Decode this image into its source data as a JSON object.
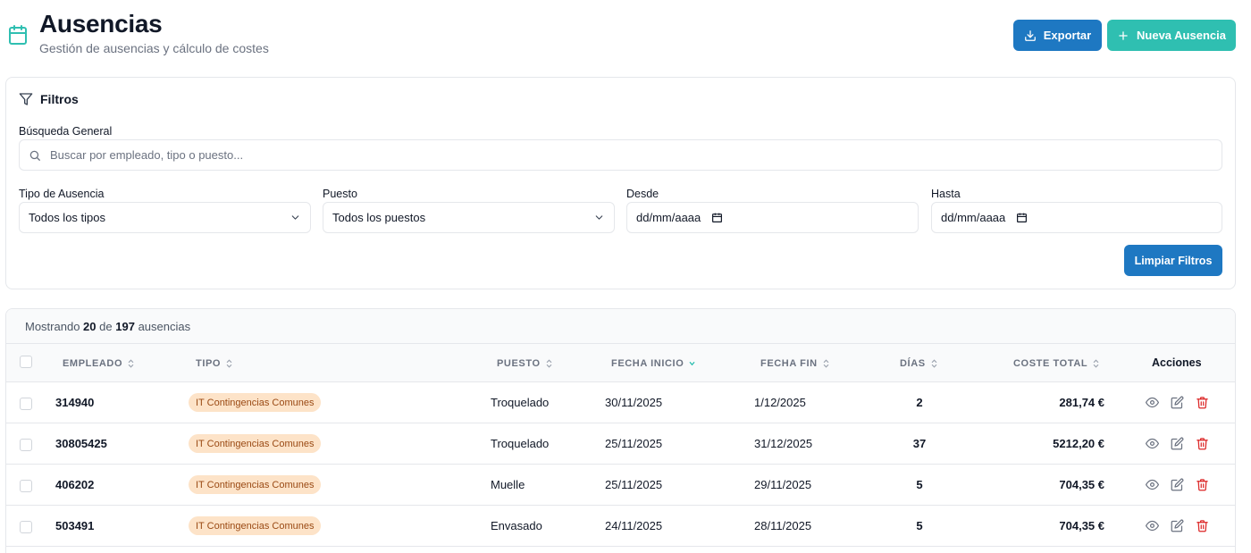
{
  "header": {
    "title": "Ausencias",
    "subtitle": "Gestión de ausencias y cálculo de costes",
    "export_label": "Exportar",
    "new_label": "Nueva Ausencia"
  },
  "filters": {
    "title": "Filtros",
    "search_label": "Búsqueda General",
    "search_placeholder": "Buscar por empleado, tipo o puesto...",
    "type_label": "Tipo de Ausencia",
    "type_value": "Todos los tipos",
    "position_label": "Puesto",
    "position_value": "Todos los puestos",
    "from_label": "Desde",
    "from_value": "dd/mm/aaaa",
    "to_label": "Hasta",
    "to_value": "dd/mm/aaaa",
    "clear_label": "Limpiar Filtros"
  },
  "table": {
    "showing_prefix": "Mostrando",
    "showing_count": "20",
    "showing_of": "de",
    "showing_total": "197",
    "showing_suffix": "ausencias",
    "columns": [
      "EMPLEADO",
      "TIPO",
      "PUESTO",
      "FECHA INICIO",
      "FECHA FIN",
      "DÍAS",
      "COSTE TOTAL",
      "Acciones"
    ],
    "sorted_column": "FECHA INICIO",
    "rows": [
      {
        "employee": "314940",
        "type": "IT Contingencias Comunes",
        "position": "Troquelado",
        "start": "30/11/2025",
        "end": "1/12/2025",
        "days": "2",
        "cost": "281,74 €"
      },
      {
        "employee": "30805425",
        "type": "IT Contingencias Comunes",
        "position": "Troquelado",
        "start": "25/11/2025",
        "end": "31/12/2025",
        "days": "37",
        "cost": "5212,20 €"
      },
      {
        "employee": "406202",
        "type": "IT Contingencias Comunes",
        "position": "Muelle",
        "start": "25/11/2025",
        "end": "29/11/2025",
        "days": "5",
        "cost": "704,35 €"
      },
      {
        "employee": "503491",
        "type": "IT Contingencias Comunes",
        "position": "Envasado",
        "start": "24/11/2025",
        "end": "28/11/2025",
        "days": "5",
        "cost": "704,35 €"
      }
    ]
  },
  "colors": {
    "primary": "#1e78c2",
    "accent": "#2fbfb1",
    "badge_bg": "#fde3c8",
    "badge_text": "#9a4a14",
    "delete": "#dc2626"
  },
  "icons": {
    "header": "calendar-icon",
    "export": "download-icon",
    "new": "plus-icon",
    "filter": "funnel-icon",
    "search": "search-icon",
    "select": "chevron-down-icon",
    "date": "calendar-icon",
    "sort": "sort-icon",
    "view": "eye-icon",
    "edit": "edit-icon",
    "delete": "trash-icon"
  }
}
